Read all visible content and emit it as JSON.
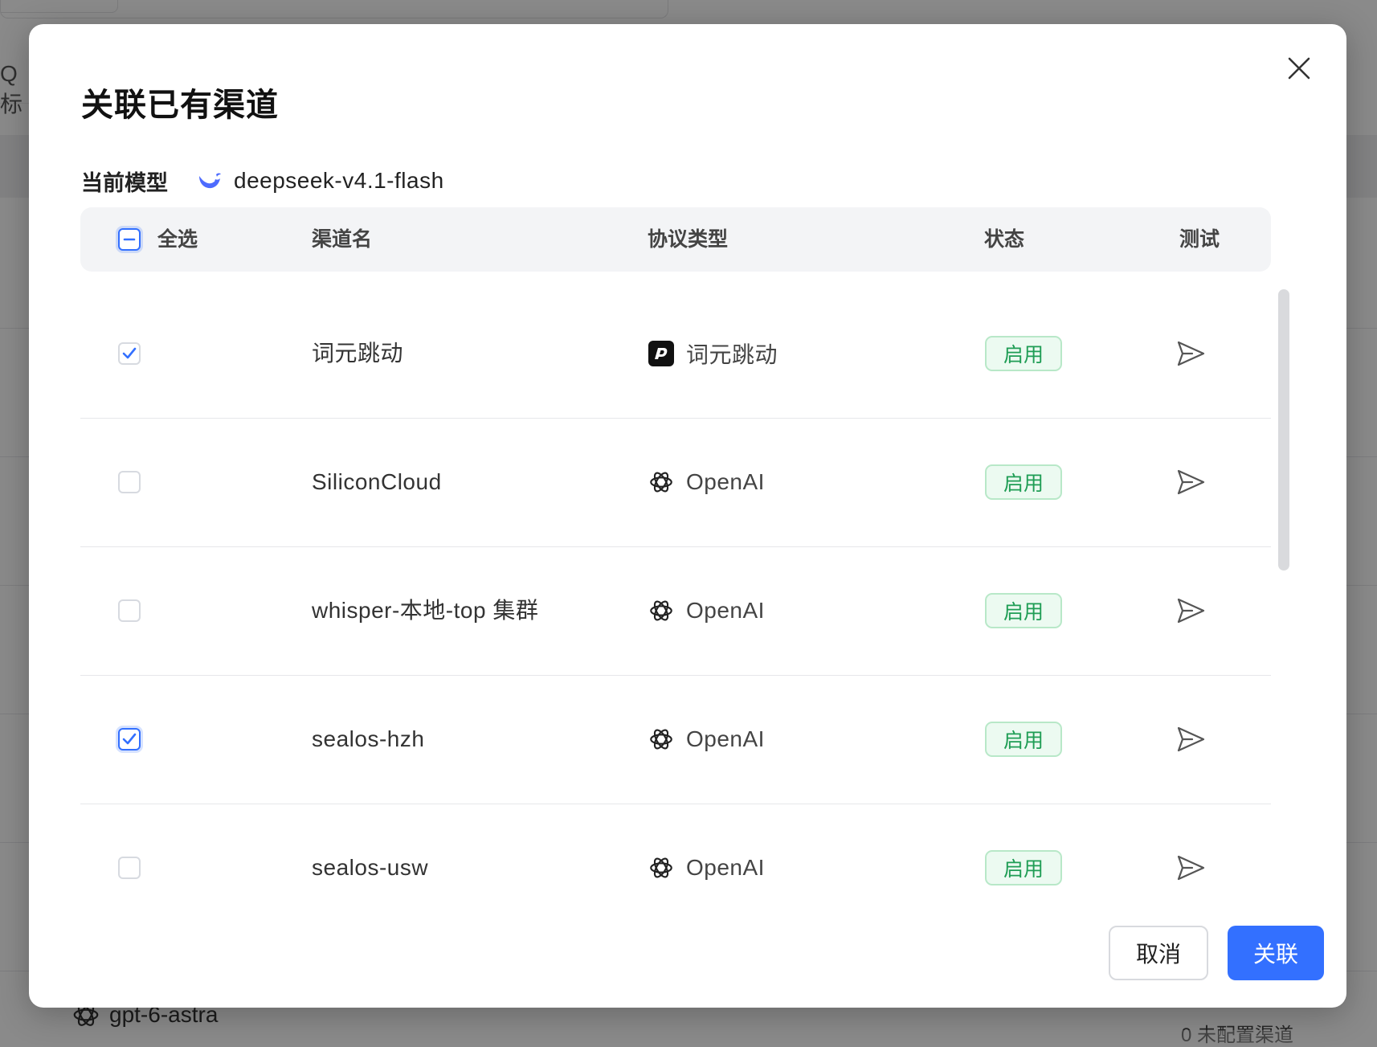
{
  "background": {
    "search_char": "Q 标",
    "bottom_item": "gpt-6-astra",
    "bottom_right": "0 未配置渠道"
  },
  "dialog": {
    "title": "关联已有渠道",
    "current_model_label": "当前模型",
    "current_model": "deepseek-v4.1-flash",
    "columns": {
      "select_all": "全选",
      "name": "渠道名",
      "protocol": "协议类型",
      "status": "状态",
      "test": "测试"
    },
    "rows": [
      {
        "checked": true,
        "name": "词元跳动",
        "protocol": "词元跳动",
        "protocol_icon": "ciyuan-logo-icon",
        "status": "启用"
      },
      {
        "checked": false,
        "name": "SiliconCloud",
        "protocol": "OpenAI",
        "protocol_icon": "openai-icon",
        "status": "启用"
      },
      {
        "checked": false,
        "name": "whisper-本地-top 集群",
        "protocol": "OpenAI",
        "protocol_icon": "openai-icon",
        "status": "启用"
      },
      {
        "checked": true,
        "name": "sealos-hzh",
        "protocol": "OpenAI",
        "protocol_icon": "openai-icon",
        "status": "启用"
      },
      {
        "checked": false,
        "name": "sealos-usw",
        "protocol": "OpenAI",
        "protocol_icon": "openai-icon",
        "status": "启用"
      }
    ],
    "buttons": {
      "cancel": "取消",
      "confirm": "关联"
    }
  },
  "colors": {
    "primary": "#3370ff",
    "status_green": "#1f9d55",
    "status_bg": "#ecfaf1"
  }
}
